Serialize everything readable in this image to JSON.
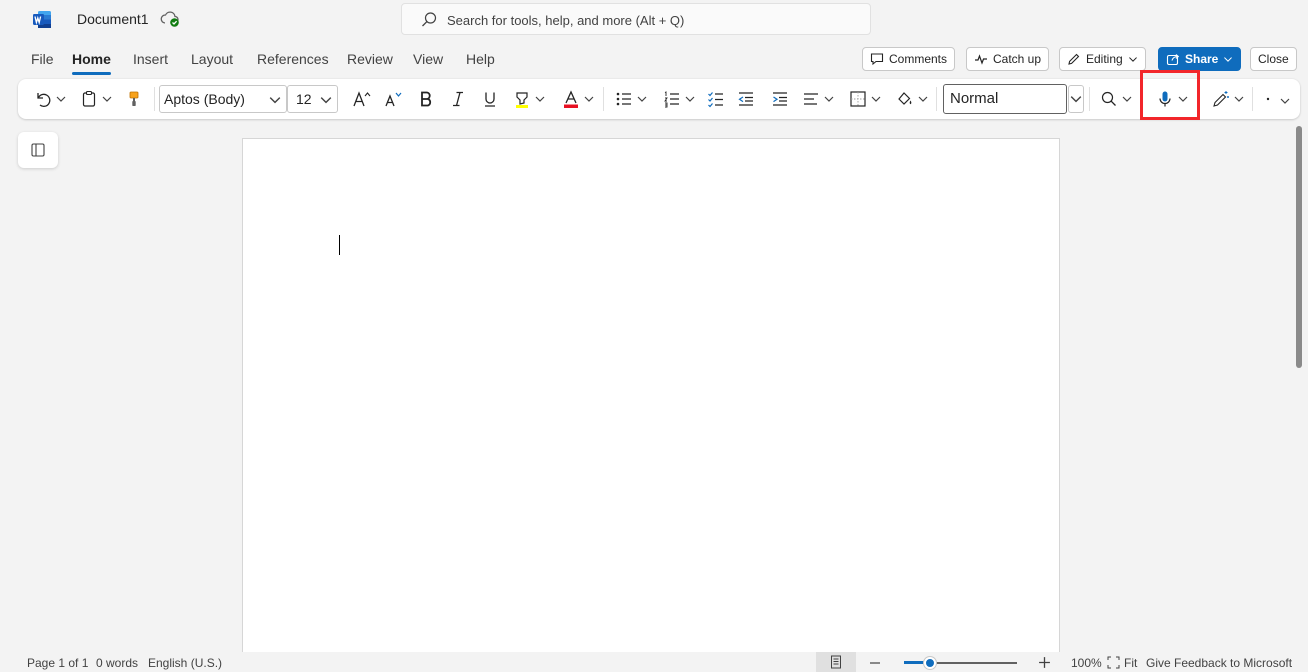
{
  "app": {
    "document_name": "Document1",
    "search_placeholder": "Search for tools, help, and more (Alt + Q)"
  },
  "menu": {
    "tabs": [
      "File",
      "Home",
      "Insert",
      "Layout",
      "References",
      "Review",
      "View",
      "Help"
    ],
    "active_tab": "Home",
    "comments_label": "Comments",
    "catchup_label": "Catch up",
    "editing_label": "Editing",
    "share_label": "Share",
    "close_label": "Close"
  },
  "ribbon": {
    "font_name": "Aptos (Body)",
    "font_size": "12",
    "style_name": "Normal",
    "highlighted_control": "dictate-button"
  },
  "status": {
    "page": "Page 1 of 1",
    "words": "0 words",
    "language": "English (U.S.)",
    "zoom": "100%",
    "fit_label": "Fit",
    "feedback": "Give Feedback to Microsoft",
    "zoom_fraction": 0.23
  },
  "colors": {
    "accent": "#0f6cbd",
    "highlight_box": "#f2262a",
    "font_color_bar": "#e81123",
    "highlighter_bar": "#ffff00",
    "format_painter": "#f7a21b"
  }
}
